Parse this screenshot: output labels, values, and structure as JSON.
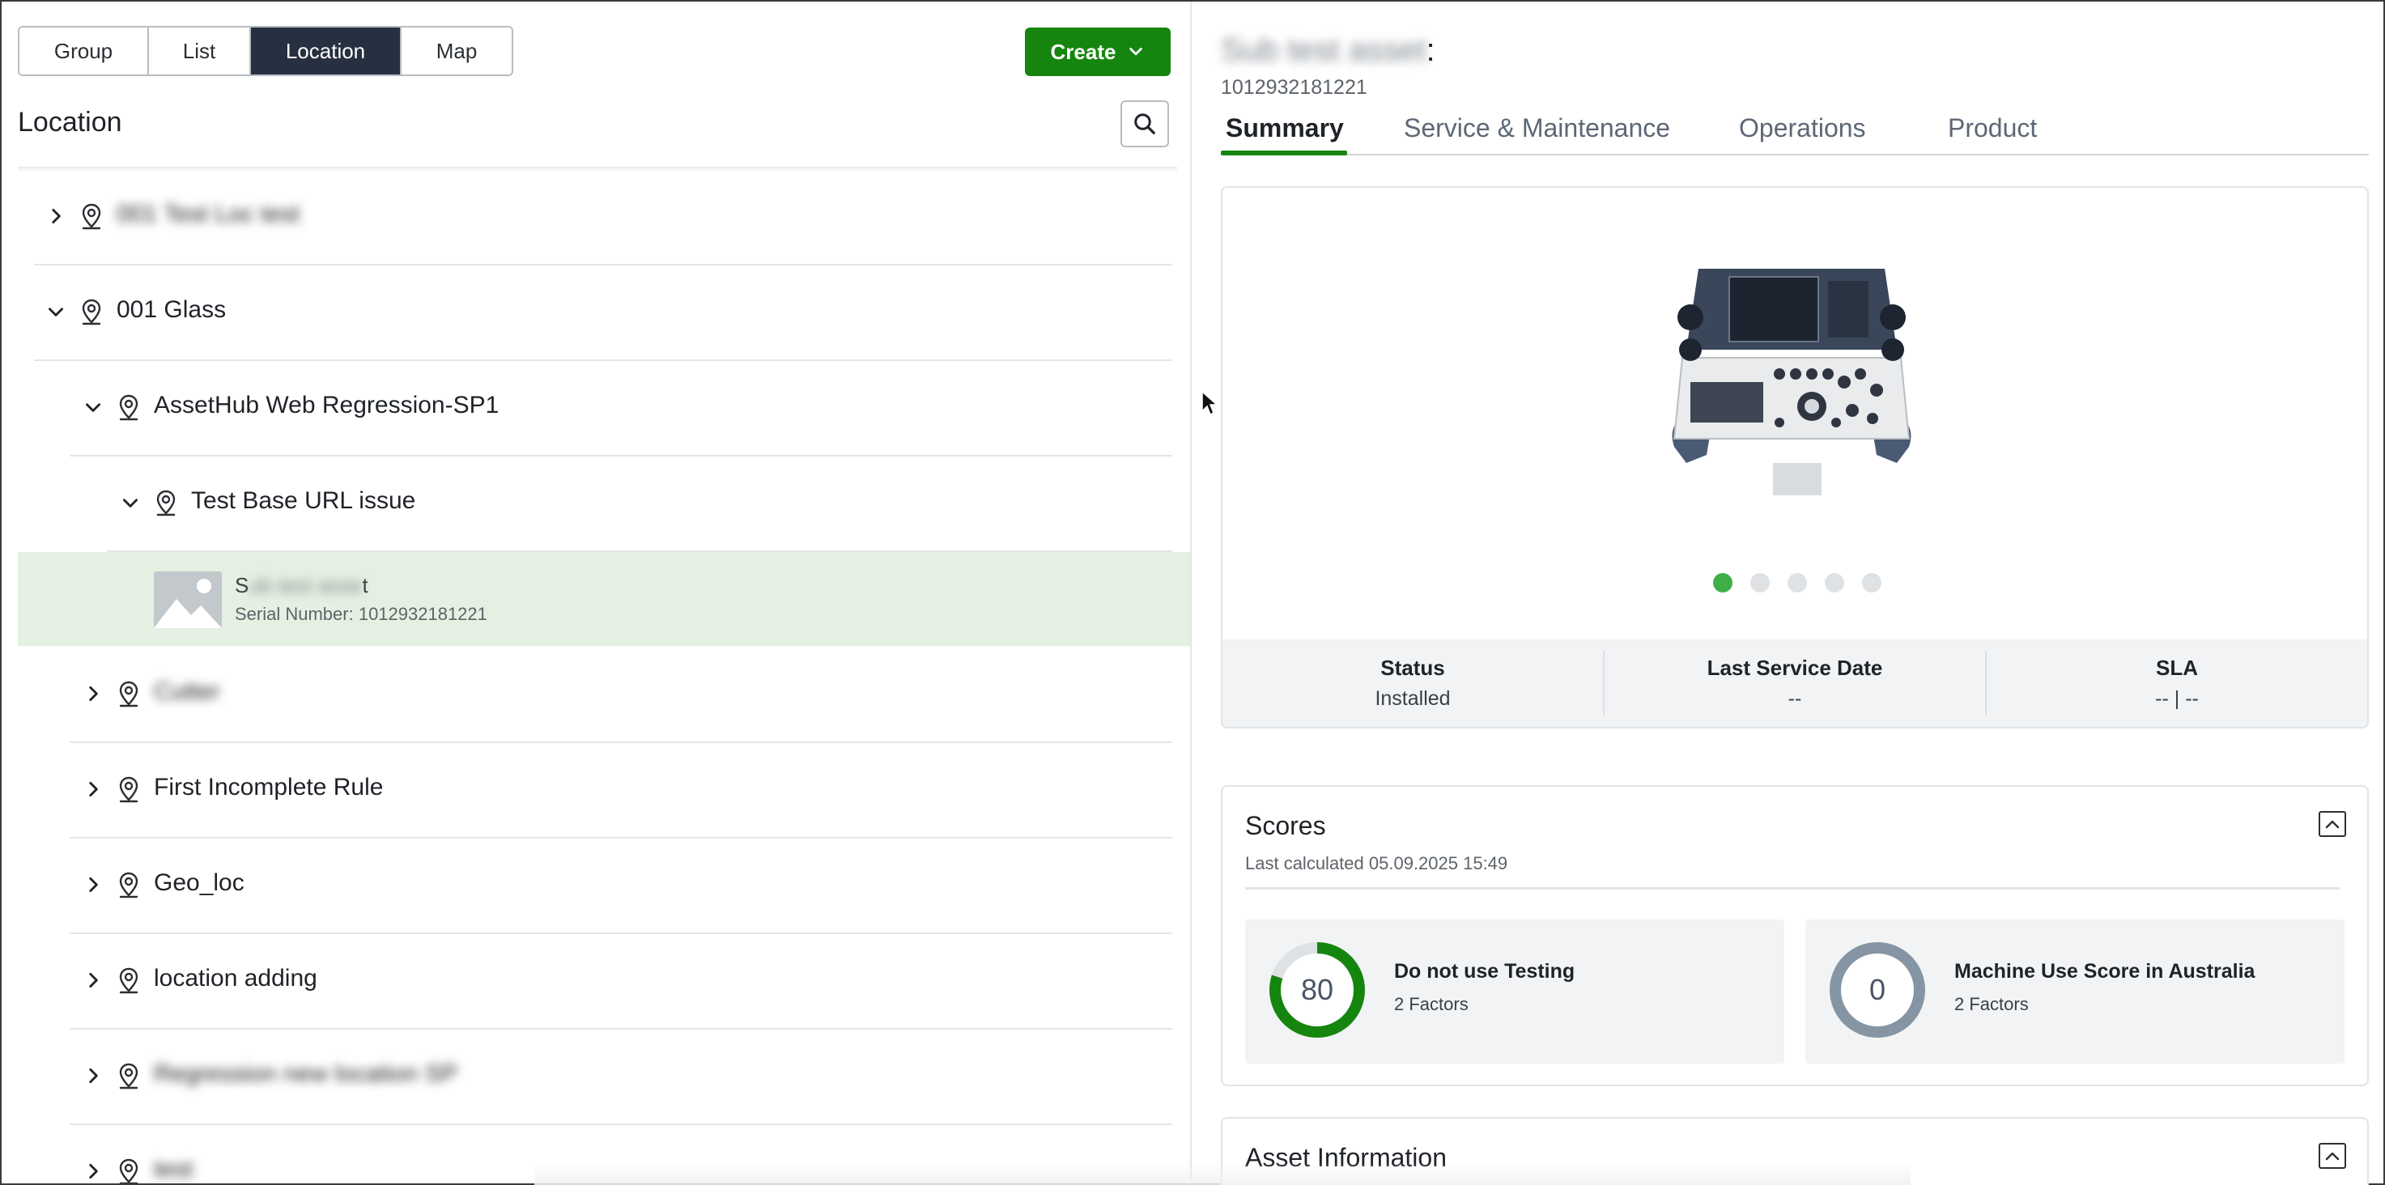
{
  "view_switcher": {
    "options": [
      "Group",
      "List",
      "Location",
      "Map"
    ],
    "selected": "Location"
  },
  "create_button": {
    "label": "Create"
  },
  "left_panel": {
    "title": "Location"
  },
  "tree": {
    "rows": [
      {
        "label": "001 Test Loc test",
        "expanded": false,
        "blurred": true
      },
      {
        "label": "001 Glass",
        "expanded": true,
        "blurred": false
      },
      {
        "label": "AssetHub Web Regression-SP1",
        "expanded": true,
        "blurred": false
      },
      {
        "label": "Test Base URL issue",
        "expanded": true,
        "blurred": false
      },
      {
        "label": "Cutter",
        "expanded": false,
        "blurred": true
      },
      {
        "label": "First Incomplete Rule",
        "expanded": false,
        "blurred": false
      },
      {
        "label": "Geo_loc",
        "expanded": false,
        "blurred": false
      },
      {
        "label": "location adding",
        "expanded": false,
        "blurred": false
      },
      {
        "label": "Regression new location SP",
        "expanded": false,
        "blurred": true
      },
      {
        "label": "test",
        "expanded": false,
        "blurred": true
      }
    ],
    "selected_asset": {
      "name_visible_start": "S",
      "name_hidden": "ub test asse",
      "name_visible_end": "t",
      "serial": "Serial Number: 1012932181221"
    }
  },
  "asset_header": {
    "name_hidden": "Sub test asset",
    "name_suffix": ":",
    "id": "1012932181221"
  },
  "tabs": [
    "Summary",
    "Service & Maintenance",
    "Operations",
    "Product"
  ],
  "active_tab": "Summary",
  "carousel": {
    "slide_count": 5,
    "active_index": 0
  },
  "summary_stats": [
    {
      "label": "Status",
      "value": "Installed"
    },
    {
      "label": "Last Service Date",
      "value": "--"
    },
    {
      "label": "SLA",
      "value": "-- | --"
    }
  ],
  "scores": {
    "title": "Scores",
    "last_calculated": "Last calculated 05.09.2025 15:49",
    "items": [
      {
        "value": "80",
        "fraction": 0.8,
        "name": "Do not use Testing",
        "factors": "2 Factors",
        "color": "#16850f"
      },
      {
        "value": "0",
        "fraction": 0.0,
        "name": "Machine Use Score in Australia",
        "factors": "2 Factors",
        "color": "#8595a3"
      }
    ]
  },
  "asset_information": {
    "title": "Asset Information"
  },
  "colors": {
    "accent_green": "#16850f",
    "selected_row_bg": "#e4f1e2",
    "segment_active_bg": "#263040",
    "carousel_active_dot": "#3fae49"
  }
}
